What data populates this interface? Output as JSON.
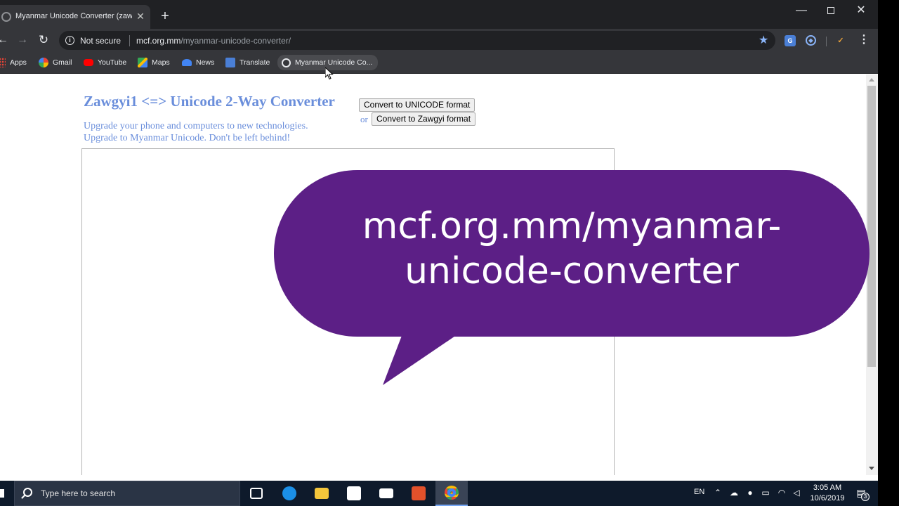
{
  "browser": {
    "tab_title": "Myanmar Unicode Converter (zawgyi",
    "tab_close": "✕",
    "new_tab": "+",
    "window_min": "—",
    "window_close": "✕",
    "nav_back": "←",
    "nav_forward": "→",
    "nav_reload": "↻",
    "not_secure": "Not secure",
    "url_domain": "mcf.org.mm",
    "url_path": "/myanmar-unicode-converter/",
    "star": "★",
    "menu": "⋮"
  },
  "bookmarks": [
    {
      "label": "Apps",
      "icon": "apps-grid-icon"
    },
    {
      "label": "Gmail",
      "icon": "google-icon"
    },
    {
      "label": "YouTube",
      "icon": "youtube-icon"
    },
    {
      "label": "Maps",
      "icon": "maps-icon"
    },
    {
      "label": "News",
      "icon": "news-icon"
    },
    {
      "label": "Translate",
      "icon": "translate-icon"
    },
    {
      "label": "Myanmar Unicode Co...",
      "icon": "globe-icon"
    }
  ],
  "page": {
    "title": "Zawgyi1 <=> Unicode 2-Way Converter",
    "tagline_1": "Upgrade your phone and computers to new technologies.",
    "tagline_2": "Upgrade to Myanmar Unicode. Don't be left behind!",
    "btn_unicode": "Convert to UNICODE format",
    "or_label": "or",
    "btn_zawgyi": "Convert to Zawgyi format"
  },
  "overlay": {
    "line_1": "mcf.org.mm/myanmar-",
    "line_2": "unicode-converter",
    "color": "#5c1f86"
  },
  "taskbar": {
    "search_placeholder": "Type here to search",
    "language": "EN",
    "time": "3:05 AM",
    "date": "10/6/2019",
    "notification_count": "3"
  }
}
